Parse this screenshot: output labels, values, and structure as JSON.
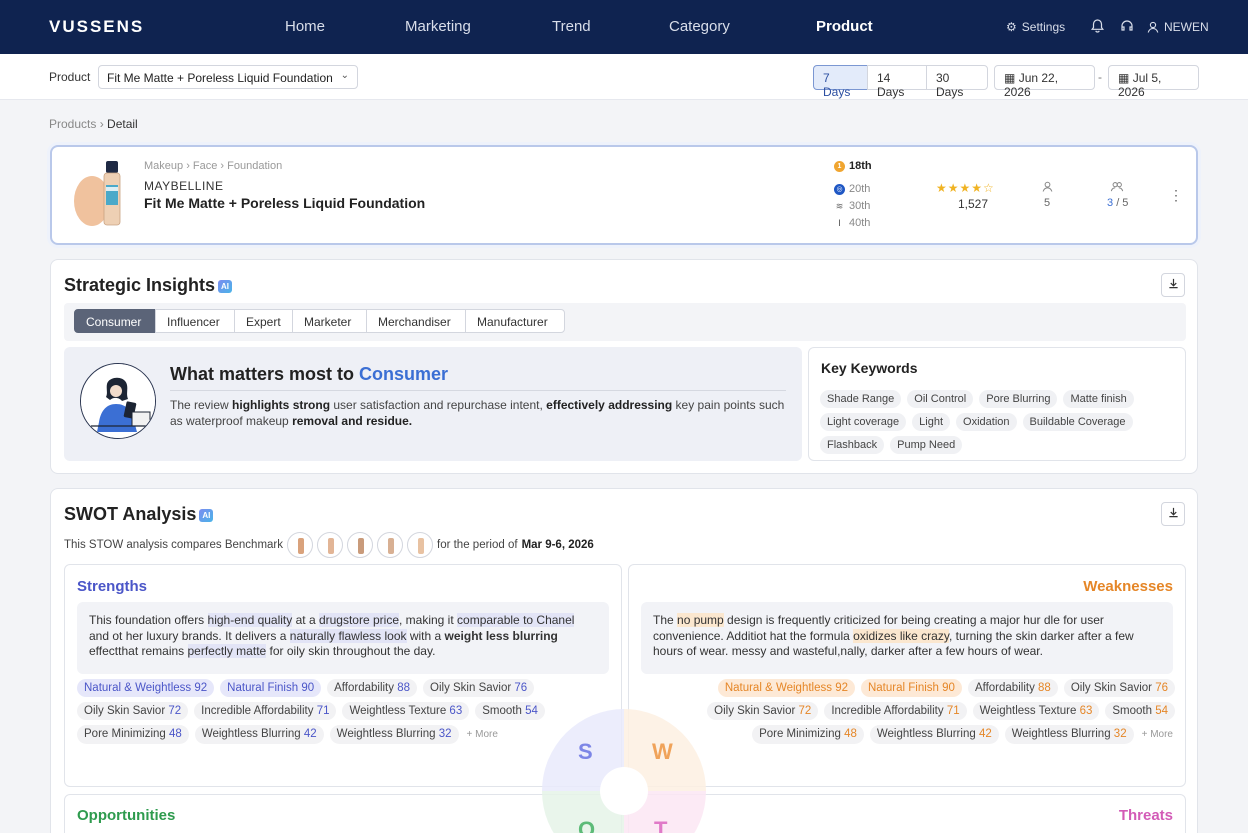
{
  "nav": {
    "logo": "VUSSENS",
    "links": [
      "Home",
      "Marketing",
      "Trend",
      "Category",
      "Product"
    ],
    "settings": "Settings",
    "user": "NEWEN"
  },
  "filter": {
    "label": "Product",
    "selected_product": "Fit Me Matte + Poreless Liquid Foundation",
    "ranges": [
      "7 Days",
      "14 Days",
      "30 Days"
    ],
    "active_range": "7 Days",
    "start_date": "Jun 22, 2026",
    "end_date": "Jul 5, 2026",
    "separator": "-"
  },
  "breadcrumb": {
    "parent": "Products",
    "sep": "›",
    "current": "Detail"
  },
  "product": {
    "category_path": "Makeup › Face › Foundation",
    "brand": "MAYBELLINE",
    "name": "Fit Me Matte + Poreless Liquid Foundation",
    "ranks": [
      "18th",
      "20th",
      "30th",
      "40th"
    ],
    "rating": 4,
    "rating_stars": "★★★★☆",
    "review_count": "1,527",
    "stat_a": "5",
    "stat_b_num": "3",
    "stat_b_den": "/ 5",
    "menu_icon": "⋮"
  },
  "insights": {
    "title": "Strategic Insights",
    "ai": "AI",
    "tabs": [
      "Consumer",
      "Influencer",
      "Expert",
      "Marketer",
      "Merchandiser",
      "Manufacturer"
    ],
    "active_tab": "Consumer",
    "headline_prefix": "What matters most to",
    "headline_target": "Consumer",
    "text_parts": {
      "p1": "The review ",
      "b1": "highlights strong",
      "p2": " user satisfaction and repurchase intent, ",
      "b2": "effectively addressing",
      "p3": " key pain points such as waterproof makeup ",
      "b3": "removal and residue."
    },
    "keywords_title": "Key Keywords",
    "keywords": [
      "Shade Range",
      "Oil Control",
      "Pore Blurring",
      "Matte finish",
      "Light coverage",
      "Light",
      "Oxidation",
      "Buildable Coverage",
      "Flashback",
      "Pump Need"
    ]
  },
  "swot": {
    "title": "SWOT Analysis",
    "ai": "AI",
    "sub_prefix": "This STOW analysis compares Benchmark",
    "sub_period": "for the period of",
    "sub_dates": "Mar 9-6, 2026",
    "strengths": {
      "title": "Strengths",
      "t1": "This foundation offers ",
      "h1": "high-end quality",
      "t2": " at a ",
      "h2": "drugstore price",
      "t3": ", making it ",
      "h3": "comparable to Chanel",
      "t4": " and ot her luxury brands. It delivers a ",
      "h4": "naturally flawless look",
      "t5": " with a ",
      "b5": "weight less blurring",
      "t6": " effectthat remains ",
      "h6": "perfectly matte",
      "t7": " for oily skin throughout the day.",
      "tags": [
        {
          "label": "Natural & Weightless",
          "value": "92"
        },
        {
          "label": "Natural Finish",
          "value": "90"
        },
        {
          "label": "Affordability",
          "value": "88"
        },
        {
          "label": "Oily Skin Savior",
          "value": "76"
        },
        {
          "label": "Oily Skin Savior",
          "value": "72"
        },
        {
          "label": "Incredible Affordability",
          "value": "71"
        },
        {
          "label": "Weightless Texture",
          "value": "63"
        },
        {
          "label": "Smooth",
          "value": "54"
        },
        {
          "label": "Pore Minimizing",
          "value": "48"
        },
        {
          "label": "Weightless Blurring",
          "value": "42"
        },
        {
          "label": "Weightless Blurring",
          "value": "32"
        }
      ],
      "more": "+ More"
    },
    "weaknesses": {
      "title": "Weaknesses",
      "t1": "The ",
      "h1": "no pump",
      "t2": " design is frequently criticized for being creating a major hur dle for user convenience. Additiot hat the formula ",
      "h2": "oxidizes like crazy",
      "t3": ", turning the skin darker after a few hours of wear. messy and wasteful,nally, darker after a few hours of wear.",
      "tags": [
        {
          "label": "Natural & Weightless",
          "value": "92"
        },
        {
          "label": "Natural Finish",
          "value": "90"
        },
        {
          "label": "Affordability",
          "value": "88"
        },
        {
          "label": "Oily Skin Savior",
          "value": "76"
        },
        {
          "label": "Oily Skin Savior",
          "value": "72"
        },
        {
          "label": "Incredible Affordability",
          "value": "71"
        },
        {
          "label": "Weightless Texture",
          "value": "63"
        },
        {
          "label": "Smooth",
          "value": "54"
        },
        {
          "label": "Pore Minimizing",
          "value": "48"
        },
        {
          "label": "Weightless Blurring",
          "value": "42"
        },
        {
          "label": "Weightless Blurring",
          "value": "32"
        }
      ],
      "more": "+ More"
    },
    "opportunities": {
      "title": "Opportunities"
    },
    "threats": {
      "title": "Threats"
    },
    "letters": {
      "s": "S",
      "w": "W",
      "o": "O",
      "t": "T"
    }
  },
  "colors": {
    "nav_bg": "#0f2350",
    "accent_blue": "#3b6fd4",
    "strength": "#4b56c8",
    "weakness": "#e58627",
    "opportunity": "#2e9b4e",
    "threat": "#d35bb7"
  }
}
